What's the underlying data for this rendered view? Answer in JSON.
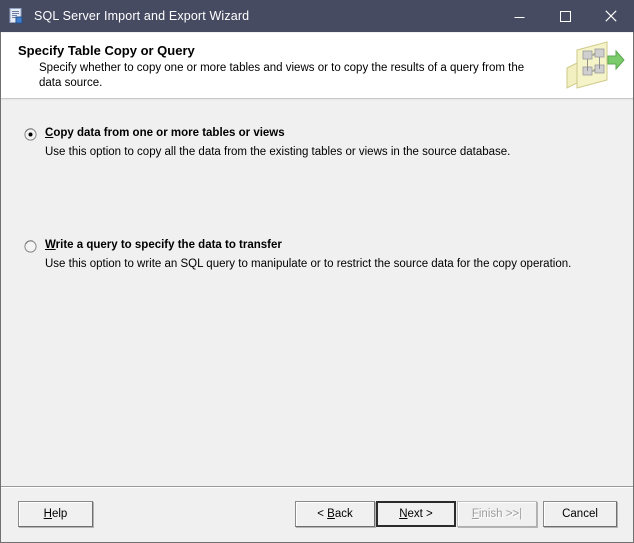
{
  "window": {
    "title": "SQL Server Import and Export Wizard",
    "icon": "wizard-document-icon",
    "controls": {
      "minimize": "minimize-icon",
      "maximize": "maximize-icon",
      "close": "close-icon"
    },
    "titlebar_color": "#474b62"
  },
  "header": {
    "title": "Specify Table Copy or Query",
    "description": "Specify whether to copy one or more tables and views or to copy the results of a query from the data source.",
    "graphic": "table-schema-transfer-icon"
  },
  "options": [
    {
      "label_prefix": "",
      "accelerator": "C",
      "label_rest": "opy data from one or more tables or views",
      "label_full": "Copy data from one or more tables or views",
      "description": "Use this option to copy all the data from the existing tables or views in the source database.",
      "selected": true
    },
    {
      "label_prefix": "",
      "accelerator": "W",
      "label_rest": "rite a query to specify the data to transfer",
      "label_full": "Write a query to specify the data to transfer",
      "description": "Use this option to write an SQL query to manipulate or to restrict the source data for the copy operation.",
      "selected": false
    }
  ],
  "footer": {
    "help": {
      "accelerator": "H",
      "rest": "elp",
      "full": "Help",
      "enabled": true
    },
    "back": {
      "prefix": "< ",
      "accelerator": "B",
      "rest": "ack",
      "full": "< Back",
      "enabled": true
    },
    "next": {
      "accelerator": "N",
      "rest": "ext >",
      "full": "Next >",
      "enabled": true,
      "default": true
    },
    "finish": {
      "accelerator": "F",
      "rest": "inish >>|",
      "full": "Finish >>|",
      "enabled": false
    },
    "cancel": {
      "full": "Cancel",
      "enabled": true
    }
  }
}
